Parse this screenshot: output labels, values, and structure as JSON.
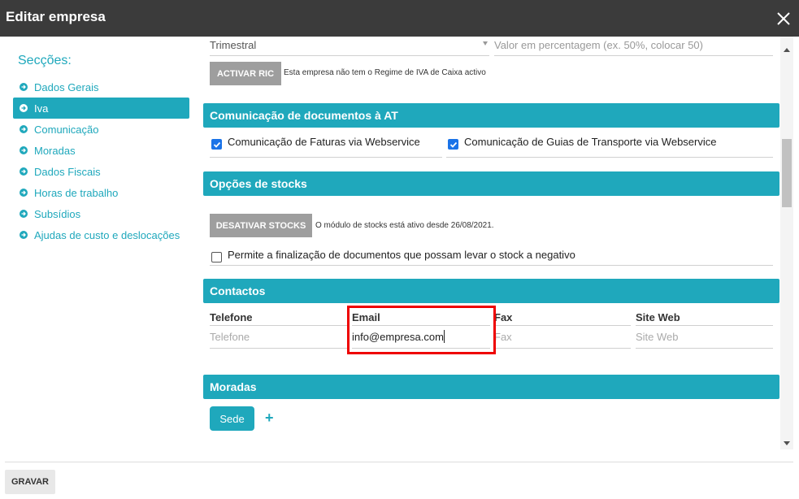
{
  "header": {
    "title": "Editar empresa"
  },
  "sidebar": {
    "title": "Secções:",
    "items": [
      {
        "label": "Dados Gerais"
      },
      {
        "label": "Iva"
      },
      {
        "label": "Comunicação"
      },
      {
        "label": "Moradas"
      },
      {
        "label": "Dados Fiscais"
      },
      {
        "label": "Horas de trabalho"
      },
      {
        "label": "Subsídios"
      },
      {
        "label": "Ajudas de custo e deslocações"
      }
    ],
    "active_index": 1
  },
  "iva": {
    "period_value": "Trimestral",
    "percent_placeholder": "Valor em percentagem (ex. 50%, colocar 50)",
    "ric_button": "ACTIVAR RIC",
    "ric_note": "Esta empresa não tem o Regime de IVA de Caixa activo"
  },
  "at_section": {
    "title": "Comunicação de documentos à AT",
    "faturas_label": "Comunicação de Faturas via Webservice",
    "faturas_checked": true,
    "guias_label": "Comunicação de Guias de Transporte via Webservice",
    "guias_checked": true
  },
  "stocks_section": {
    "title": "Opções de stocks",
    "button": "DESATIVAR STOCKS",
    "note": "O módulo de stocks está ativo desde 26/08/2021.",
    "negative_label": "Permite a finalização de documentos que possam levar o stock a negativo",
    "negative_checked": false
  },
  "contacts_section": {
    "title": "Contactos",
    "telefone_label": "Telefone",
    "telefone_placeholder": "Telefone",
    "email_label": "Email",
    "email_value": "info@empresa.com",
    "fax_label": "Fax",
    "fax_placeholder": "Fax",
    "site_label": "Site Web",
    "site_placeholder": "Site Web"
  },
  "moradas_section": {
    "title": "Moradas",
    "sede_button": "Sede",
    "add_symbol": "+"
  },
  "footer": {
    "save_button": "GRAVAR"
  },
  "colors": {
    "accent": "#1fa8bc",
    "header_bg": "#3b3b3b",
    "highlight": "#e00000"
  }
}
